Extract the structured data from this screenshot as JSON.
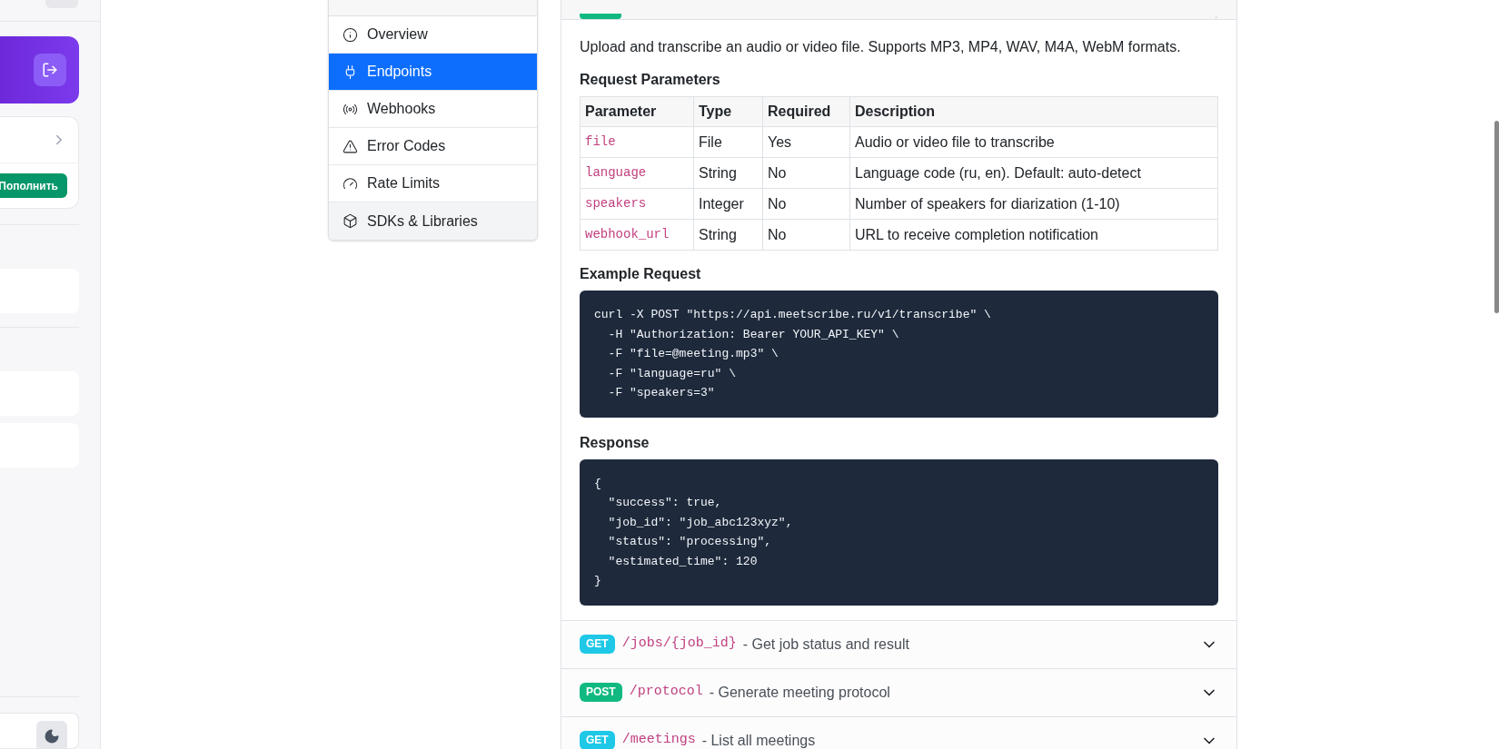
{
  "sidebar": {
    "topup_button": "Пополнить"
  },
  "contents_nav": {
    "items": [
      {
        "label": "Overview",
        "selected": false,
        "hovered": false
      },
      {
        "label": "Endpoints",
        "selected": true,
        "hovered": false
      },
      {
        "label": "Webhooks",
        "selected": false,
        "hovered": false
      },
      {
        "label": "Error Codes",
        "selected": false,
        "hovered": false
      },
      {
        "label": "Rate Limits",
        "selected": false,
        "hovered": false
      },
      {
        "label": "SDKs & Libraries",
        "selected": false,
        "hovered": true
      }
    ]
  },
  "endpoint": {
    "expanded": true,
    "color": "#10b981",
    "description": "Upload and transcribe an audio or video file. Supports MP3, MP4, WAV, M4A, WebM formats.",
    "params_title": "Request Parameters",
    "table": {
      "columns": [
        "Parameter",
        "Type",
        "Required",
        "Description"
      ],
      "rows": [
        [
          "file",
          "File",
          "Yes",
          "Audio or video file to transcribe"
        ],
        [
          "language",
          "String",
          "No",
          "Language code (ru, en). Default: auto-detect"
        ],
        [
          "speakers",
          "Integer",
          "No",
          "Number of speakers for diarization (1-10)"
        ],
        [
          "webhook_url",
          "String",
          "No",
          "URL to receive completion notification"
        ]
      ]
    },
    "example_title": "Example Request",
    "example_code": "curl -X POST \"https://api.meetscribe.ru/v1/transcribe\" \\\n  -H \"Authorization: Bearer YOUR_API_KEY\" \\\n  -F \"file=@meeting.mp3\" \\\n  -F \"language=ru\" \\\n  -F \"speakers=3\"",
    "response_title": "Response",
    "response_code": "{\n  \"success\": true,\n  \"job_id\": \"job_abc123xyz\",\n  \"status\": \"processing\",\n  \"estimated_time\": 120\n}"
  },
  "endpoints": [
    {
      "method": "GET",
      "color": "#1ec8e6",
      "path": "/jobs/{job_id}",
      "summary": "- Get job status and result",
      "expanded": false
    },
    {
      "method": "POST",
      "color": "#10b981",
      "path": "/protocol",
      "summary": "- Generate meeting protocol",
      "expanded": false
    },
    {
      "method": "GET",
      "color": "#1ec8e6",
      "path": "/meetings",
      "summary": "- List all meetings",
      "expanded": false
    }
  ]
}
